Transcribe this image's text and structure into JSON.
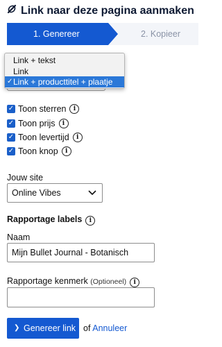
{
  "title": "Link naar deze pagina aanmaken",
  "stepper": {
    "step1": "1. Genereer",
    "step2": "2. Kopieer"
  },
  "link_type": {
    "options": [
      "Link + tekst",
      "Link",
      "Link + producttitel + plaatje"
    ],
    "selected": "Link + producttitel + plaatje"
  },
  "checkboxes": [
    {
      "label": "Toon sterren",
      "checked": true
    },
    {
      "label": "Toon prijs",
      "checked": true
    },
    {
      "label": "Toon levertijd",
      "checked": true
    },
    {
      "label": "Toon knop",
      "checked": true
    }
  ],
  "site": {
    "label": "Jouw site",
    "value": "Online Vibes"
  },
  "reporting": {
    "heading": "Rapportage labels",
    "name_label": "Naam",
    "name_value": "Mijn Bullet Journal - Botanisch",
    "kenmerk_label": "Rapportage kenmerk",
    "kenmerk_optional": "(Optioneel)",
    "kenmerk_value": ""
  },
  "actions": {
    "generate": "Genereer link",
    "or": "of",
    "cancel": "Annuleer"
  },
  "colors": {
    "primary": "#1459d1",
    "step_inactive_bg": "#f3f5f9",
    "selected_option": "#2b78d8"
  }
}
